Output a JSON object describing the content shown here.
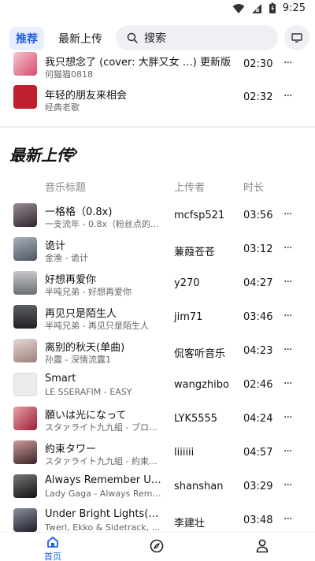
{
  "status": {
    "time": "9:25"
  },
  "header": {
    "tab_recommend": "推荐",
    "tab_latest": "最新上传",
    "search_placeholder": "搜索"
  },
  "top_list": [
    {
      "title": "我只想念了 (cover: 大胖又女 …) 更新版",
      "sub": "何猫猫0818",
      "duration": "02:30",
      "more": "···",
      "thumb_color": "#d84a6a"
    },
    {
      "title": "年轻的朋友来相会",
      "sub": "经典老歌",
      "duration": "02:32",
      "more": "···",
      "thumb_color": "#c01f2f"
    }
  ],
  "section": {
    "title": "最新上传",
    "col_title": "音乐标题",
    "col_uploader": "上传者",
    "col_duration": "时长"
  },
  "latest": [
    {
      "title": "一格格（0.8x)",
      "sub": "一支流年 - 0.8x（粉丝点的歌)",
      "uploader": "mcfsp521",
      "duration": "03:56",
      "more": "···",
      "thumb_color": "#4a3b46"
    },
    {
      "title": "诡计",
      "sub": "金渔 - 诡计",
      "uploader": "蒹葭苍苍",
      "duration": "03:12",
      "more": "···",
      "thumb_color": "#7a8290"
    },
    {
      "title": "好想再爱你",
      "sub": "半吨兄弟 - 好想再爱你",
      "uploader": "y270",
      "duration": "04:27",
      "more": "···",
      "thumb_color": "#8d8f92"
    },
    {
      "title": "再见只是陌生人",
      "sub": "半吨兄弟 - 再见只是陌生人",
      "uploader": "jim71",
      "duration": "03:46",
      "more": "···",
      "thumb_color": "#3b3d40"
    },
    {
      "title": "离别的秋天(单曲)",
      "sub": "孙露 - 深情流露1",
      "uploader": "侃客听音乐",
      "duration": "04:23",
      "more": "···",
      "thumb_color": "#c9b7b4"
    },
    {
      "title": "Smart",
      "sub": "LE SSERAFIM - EASY",
      "uploader": "wangzhibo",
      "duration": "02:46",
      "more": "···",
      "thumb_color": "#e8e8e8"
    },
    {
      "title": "願いは光になって",
      "sub": "スタァライト九九組 - ブロロ…",
      "uploader": "LYK5555",
      "duration": "04:24",
      "more": "···",
      "thumb_color": "#b83a4a"
    },
    {
      "title": "約束タワー",
      "sub": "スタァライト九九組 - 約束タ…",
      "uploader": "liiiiii",
      "duration": "04:57",
      "more": "···",
      "thumb_color": "#5a3a3e"
    },
    {
      "title": "Always Remember Us T…",
      "sub": "Lady Gaga - Always Remem…",
      "uploader": "shanshan",
      "duration": "03:29",
      "more": "···",
      "thumb_color": "#2a2a2a"
    },
    {
      "title": "Under Bright Lights(fea…",
      "sub": "Twerl, Ekko & Sidetrack, Ind…",
      "uploader": "李建壮",
      "duration": "03:48",
      "more": "···",
      "thumb_color": "#3a3c44"
    }
  ],
  "bottom_nav": {
    "home_label": "首页"
  },
  "colors": {
    "accent": "#1e5fe0",
    "tab_bg": "#e8eefe",
    "search_bg": "#eef0f4"
  }
}
